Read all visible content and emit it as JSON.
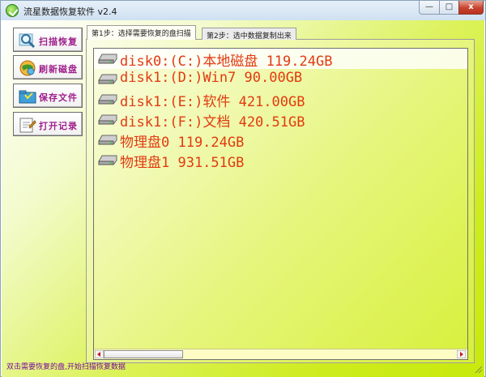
{
  "window": {
    "title": "流星数据恢复软件 v2.4"
  },
  "titlebar": {
    "minimize_glyph": "—",
    "maximize_glyph": "□",
    "close_glyph": "x"
  },
  "sidebar": {
    "items": [
      {
        "label": "扫描恢复",
        "icon": "magnifier-icon"
      },
      {
        "label": "刷新磁盘",
        "icon": "globe-refresh-icon"
      },
      {
        "label": "保存文件",
        "icon": "save-folder-icon"
      },
      {
        "label": "打开记录",
        "icon": "open-log-icon"
      }
    ]
  },
  "tabs": [
    {
      "label": "第1步：选择需要恢复的盘扫描",
      "active": true
    },
    {
      "label": "第2步：选中数据复制出来",
      "active": false
    }
  ],
  "disks": [
    {
      "label": "disk0:(C:)本地磁盘 119.24GB",
      "selected": true
    },
    {
      "label": "disk1:(D:)Win7 90.00GB",
      "selected": false
    },
    {
      "label": "disk1:(E:)软件 421.00GB",
      "selected": false
    },
    {
      "label": "disk1:(F:)文档 420.51GB",
      "selected": false
    },
    {
      "label": "物理盘0 119.24GB",
      "selected": false
    },
    {
      "label": "物理盘1 931.51GB",
      "selected": false
    }
  ],
  "status": {
    "text": "双击需要恢复的盘,开始扫描恢复数据"
  },
  "colors": {
    "accent_text": "#e23a10",
    "button_text": "#a0208c",
    "status_text": "#7a0aa0",
    "background": "#cdec1e"
  }
}
